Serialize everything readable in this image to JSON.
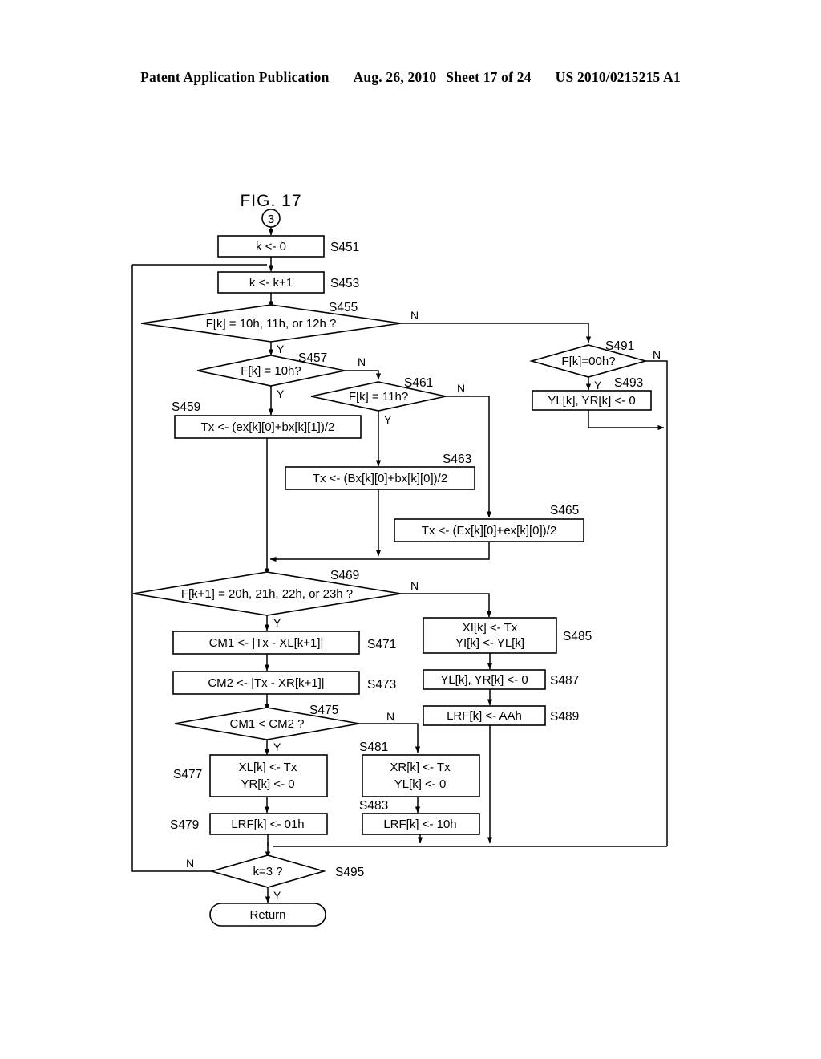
{
  "header": {
    "publication": "Patent Application Publication",
    "date": "Aug. 26, 2010",
    "sheet": "Sheet 17 of 24",
    "number": "US 2010/0215215 A1"
  },
  "figure": {
    "title": "FIG. 17",
    "entry_connector": "3"
  },
  "chart_data": {
    "type": "diagram",
    "diagram_kind": "flowchart",
    "title": "FIG. 17"
  },
  "nodes": {
    "s451": {
      "id": "S451",
      "text": "k <-  0",
      "shape": "process"
    },
    "s453": {
      "id": "S453",
      "text": "k <-  k+1",
      "shape": "process"
    },
    "s455": {
      "id": "S455",
      "text": "F[k] = 10h, 11h, or 12h ?",
      "shape": "decision"
    },
    "s457": {
      "id": "S457",
      "text": "F[k] = 10h?",
      "shape": "decision"
    },
    "s461": {
      "id": "S461",
      "text": "F[k] = 11h?",
      "shape": "decision"
    },
    "s459": {
      "id": "S459",
      "text": "Tx  <-  (ex[k][0]+bx[k][1])/2",
      "shape": "process"
    },
    "s463": {
      "id": "S463",
      "text": "Tx  <-  (Bx[k][0]+bx[k][0])/2",
      "shape": "process"
    },
    "s465": {
      "id": "S465",
      "text": "Tx  <-  (Ex[k][0]+ex[k][0])/2",
      "shape": "process"
    },
    "s491": {
      "id": "S491",
      "text": "F[k]=00h?",
      "shape": "decision"
    },
    "s493": {
      "id": "S493",
      "text": "YL[k], YR[k] <-  0",
      "shape": "process"
    },
    "s469": {
      "id": "S469",
      "text": "F[k+1] = 20h, 21h, 22h, or 23h ?",
      "shape": "decision"
    },
    "s471": {
      "id": "S471",
      "text": "CM1  <-  |Tx - XL[k+1]|",
      "shape": "process"
    },
    "s473": {
      "id": "S473",
      "text": "CM2  <-  |Tx - XR[k+1]|",
      "shape": "process"
    },
    "s475": {
      "id": "S475",
      "text": "CM1 < CM2 ?",
      "shape": "decision"
    },
    "s477": {
      "id": "S477",
      "line1": "XL[k]  <-  Tx",
      "line2": "YR[k] <-  0",
      "shape": "process"
    },
    "s479": {
      "id": "S479",
      "text": "LRF[k]  <-  01h",
      "shape": "process"
    },
    "s481": {
      "id": "S481",
      "line1": "XR[k]  <-  Tx",
      "line2": "YL[k] <-  0",
      "shape": "process"
    },
    "s483": {
      "id": "S483",
      "text": "LRF[k]  <-  10h",
      "shape": "process"
    },
    "s485": {
      "id": "S485",
      "line1": "XI[k]  <- Tx",
      "line2": "YI[k]  <-  YL[k]",
      "shape": "process"
    },
    "s487": {
      "id": "S487",
      "text": "YL[k], YR[k] <-  0",
      "shape": "process"
    },
    "s489": {
      "id": "S489",
      "text": "LRF[k]  <-  AAh",
      "shape": "process"
    },
    "s495": {
      "id": "S495",
      "text": "k=3 ?",
      "shape": "decision"
    },
    "ret": {
      "text": "Return",
      "shape": "terminator"
    }
  },
  "branch_labels": {
    "yes": "Y",
    "no": "N"
  },
  "colors": {
    "ink": "#000000",
    "paper": "#ffffff"
  }
}
